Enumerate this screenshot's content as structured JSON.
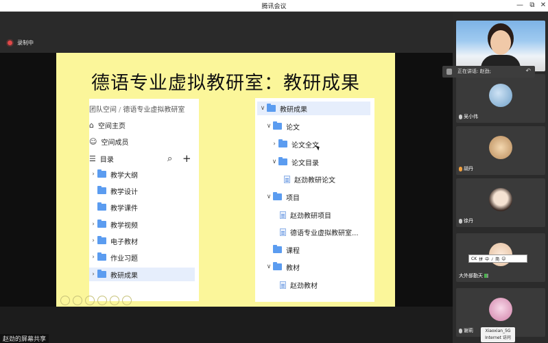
{
  "window": {
    "title": "腾讯会议",
    "controls": [
      "—",
      "⧉",
      "✕"
    ]
  },
  "recording": {
    "label": "录制中"
  },
  "slide": {
    "title": "德语专业虚拟教研室：教研成果",
    "left_panel": {
      "breadcrumb": [
        "团队空间",
        "德语专业虚拟教研室"
      ],
      "nav": [
        {
          "icon": "home-icon",
          "glyph": "⌂",
          "label": "空间主页"
        },
        {
          "icon": "members-icon",
          "glyph": "☺",
          "label": "空间成员"
        },
        {
          "icon": "menu-icon",
          "glyph": "☰",
          "label": "目录"
        }
      ],
      "tools": {
        "search": "⌕",
        "add": "+"
      },
      "folders": [
        "教学大纲",
        "教学设计",
        "教学课件",
        "教学视频",
        "电子教材",
        "作业习题",
        "教研成果"
      ]
    },
    "right_tree": [
      {
        "type": "folder",
        "chev": "∨",
        "label": "教研成果"
      },
      {
        "type": "folder",
        "chev": "∨",
        "label": "论文"
      },
      {
        "type": "folder",
        "chev": "›",
        "label": "论文全文"
      },
      {
        "type": "folder",
        "chev": "∨",
        "label": "论文目录"
      },
      {
        "type": "doc",
        "chev": "",
        "label": "赵劲教研论文"
      },
      {
        "type": "folder",
        "chev": "∨",
        "label": "项目"
      },
      {
        "type": "doc",
        "chev": "",
        "label": "赵劲教研项目"
      },
      {
        "type": "doc",
        "chev": "",
        "label": "德语专业虚拟教研室..."
      },
      {
        "type": "folder",
        "chev": "",
        "label": "课程"
      },
      {
        "type": "folder",
        "chev": "∨",
        "label": "教材"
      },
      {
        "type": "doc",
        "chev": "",
        "label": "赵劲教材"
      }
    ]
  },
  "share_label": "赵劲的屏幕共享",
  "speaking": {
    "label": "正在讲话: 赵劲;",
    "back_glyph": "↶"
  },
  "participants": [
    {
      "name": "吴小伟"
    },
    {
      "name": "胡丹"
    },
    {
      "name": "徐丹"
    },
    {
      "name": "大外部勤天",
      "keyboard": [
        "CK",
        "拼",
        "中",
        "ﾉ",
        "简",
        "☺"
      ]
    },
    {
      "name": "谢莉"
    }
  ],
  "network_badge": {
    "line1": "Xiaoxian_5G",
    "line2": "Internet 访问"
  },
  "colors": {
    "slide_bg": "#fbf69a",
    "folder": "#5b9cf0",
    "recording": "#e04848",
    "selected_row": "#e6eefc"
  }
}
